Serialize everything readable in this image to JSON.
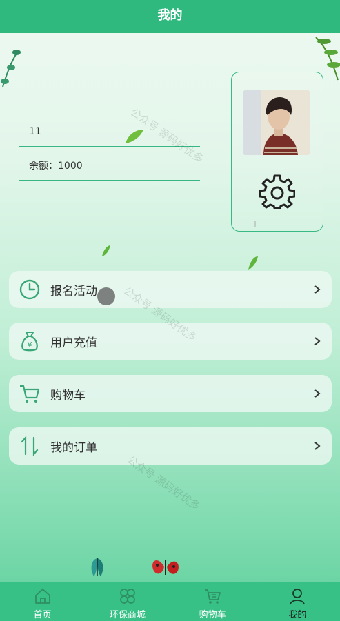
{
  "header": {
    "title": "我的"
  },
  "profile": {
    "username": "11",
    "balance_text": "余额：1000"
  },
  "menu": [
    {
      "label": "报名活动",
      "icon": "clock-icon"
    },
    {
      "label": "用户充值",
      "icon": "money-bag-icon"
    },
    {
      "label": "购物车",
      "icon": "cart-icon"
    },
    {
      "label": "我的订单",
      "icon": "sort-arrows-icon"
    }
  ],
  "watermark": "公众号  源码好优多",
  "tabbar": [
    {
      "label": "首页",
      "icon": "home-icon",
      "active": false
    },
    {
      "label": "环保商城",
      "icon": "grid-icon",
      "active": false
    },
    {
      "label": "购物车",
      "icon": "cart-icon",
      "active": false
    },
    {
      "label": "我的",
      "icon": "user-icon",
      "active": true
    }
  ],
  "colors": {
    "accent": "#2fb97f",
    "tabbar": "#37c186"
  }
}
